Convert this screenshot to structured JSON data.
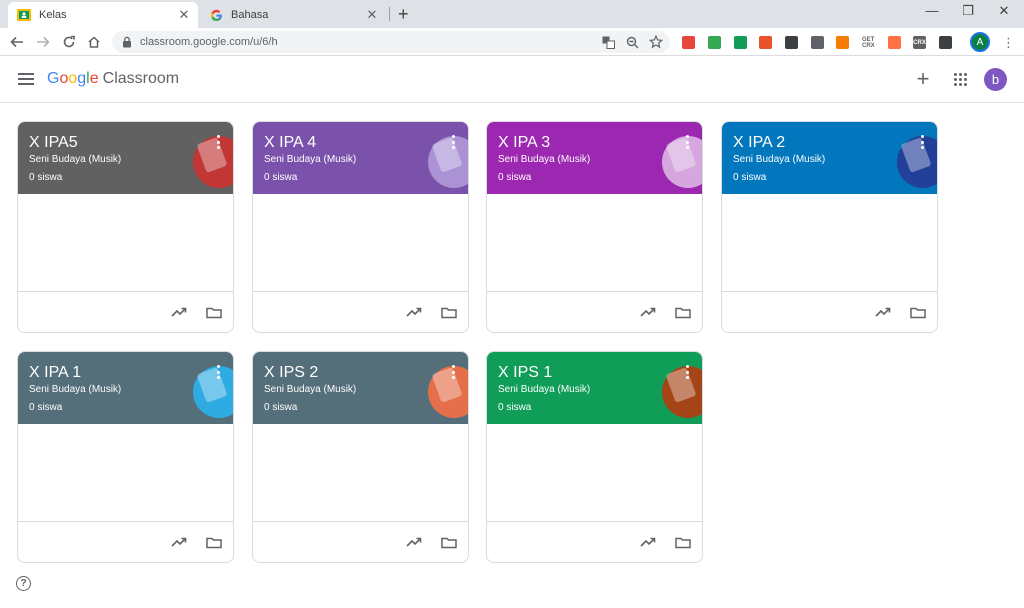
{
  "browser": {
    "tabs": [
      {
        "title": "Kelas",
        "active": true
      },
      {
        "title": "Bahasa",
        "active": false
      }
    ],
    "url": "classroom.google.com/u/6/h",
    "profile_initial": "A",
    "extensions": [
      {
        "name": "ext-1",
        "color": "#e8453c",
        "label": ""
      },
      {
        "name": "ext-2",
        "color": "#34a853",
        "label": ""
      },
      {
        "name": "ext-3",
        "color": "#0f9d58",
        "label": ""
      },
      {
        "name": "ext-4",
        "color": "#e8532c",
        "label": ""
      },
      {
        "name": "ext-5",
        "color": "#3c4043",
        "label": ""
      },
      {
        "name": "ext-6",
        "color": "#5f6368",
        "label": ""
      },
      {
        "name": "ext-7",
        "color": "#f57c00",
        "label": ""
      },
      {
        "name": "ext-8",
        "color": "#ffffff",
        "label": "GET CRX"
      },
      {
        "name": "ext-9",
        "color": "#ff7043",
        "label": ""
      },
      {
        "name": "ext-10",
        "color": "#616161",
        "label": "CRX"
      },
      {
        "name": "ext-11",
        "color": "#3c4043",
        "label": ""
      }
    ]
  },
  "app": {
    "logo_letters": [
      "G",
      "o",
      "o",
      "g",
      "l",
      "e"
    ],
    "product": "Classroom",
    "user_initial": "b",
    "help_label": "?"
  },
  "courses": [
    {
      "title": "X IPA5",
      "subtitle": "Seni Budaya (Musik)",
      "count": "0 siswa",
      "color": "#616161",
      "accent": "#d32f2f"
    },
    {
      "title": "X IPA 4",
      "subtitle": "Seni Budaya (Musik)",
      "count": "0 siswa",
      "color": "#7b52ab",
      "accent": "#b39ddb"
    },
    {
      "title": "X IPA 3",
      "subtitle": "Seni Budaya (Musik)",
      "count": "0 siswa",
      "color": "#9c27b0",
      "accent": "#e1bee7"
    },
    {
      "title": "X IPA 2",
      "subtitle": "Seni Budaya (Musik)",
      "count": "0 siswa",
      "color": "#0277bd",
      "accent": "#283593"
    },
    {
      "title": "X IPA 1",
      "subtitle": "Seni Budaya (Musik)",
      "count": "0 siswa",
      "color": "#546e7a",
      "accent": "#29b6f6"
    },
    {
      "title": "X IPS 2",
      "subtitle": "Seni Budaya (Musik)",
      "count": "0 siswa",
      "color": "#546e7a",
      "accent": "#ff7043"
    },
    {
      "title": "X IPS 1",
      "subtitle": "Seni Budaya (Musik)",
      "count": "0 siswa",
      "color": "#0f9d58",
      "accent": "#bf360c"
    }
  ]
}
